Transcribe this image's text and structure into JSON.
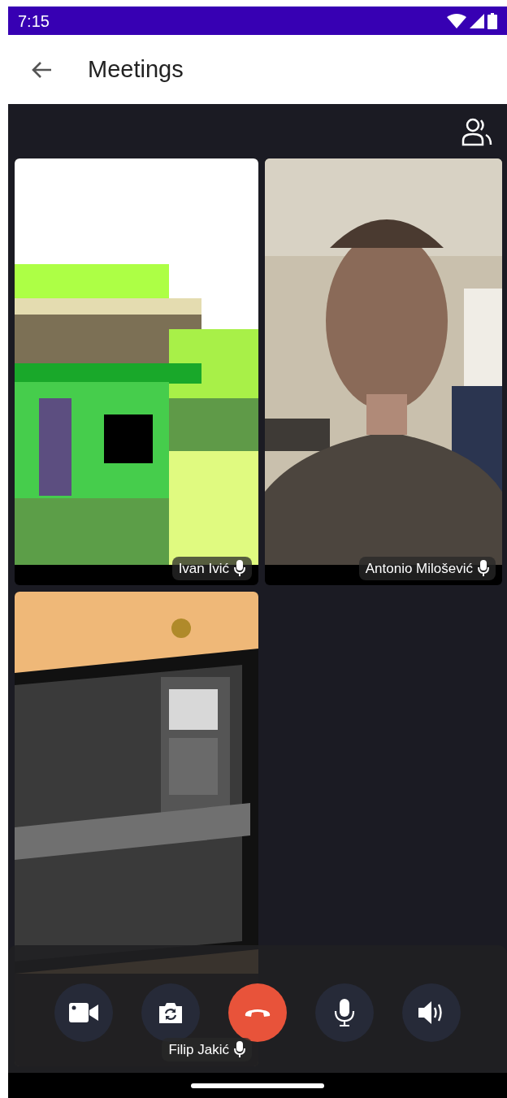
{
  "status_bar": {
    "time": "7:15"
  },
  "app_bar": {
    "title": "Meetings"
  },
  "participants": [
    {
      "name": "Ivan Ivić",
      "kind": "pixels"
    },
    {
      "name": "Antonio Milošević",
      "kind": "room"
    },
    {
      "name": "Filip Jakić",
      "kind": "monitor"
    }
  ],
  "controls": [
    {
      "kind": "camera"
    },
    {
      "kind": "flip"
    },
    {
      "kind": "hangup"
    },
    {
      "kind": "mic"
    },
    {
      "kind": "speaker"
    }
  ]
}
